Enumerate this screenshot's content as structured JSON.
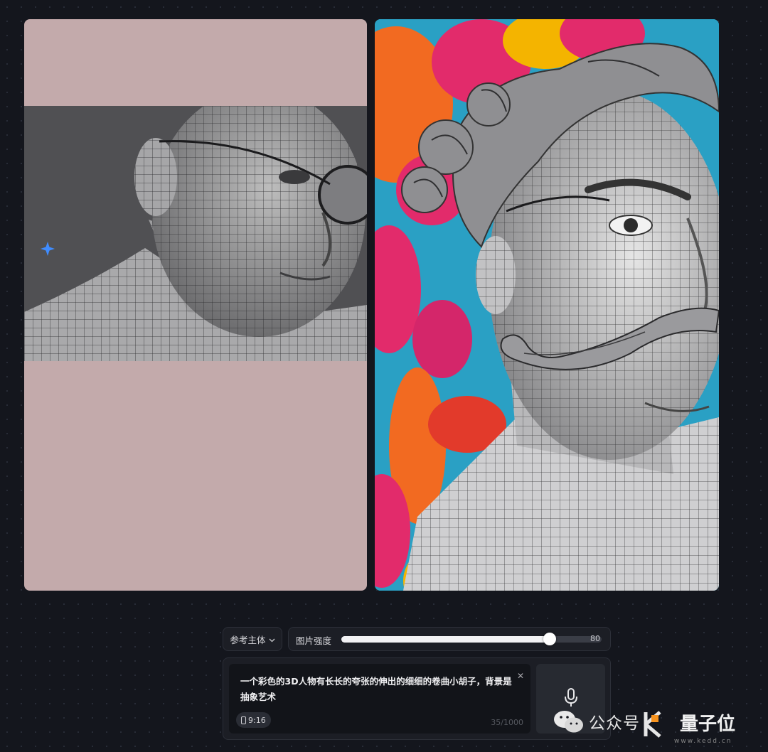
{
  "controls": {
    "subject_label": "参考主体",
    "strength_label": "图片强度",
    "strength_value": "80",
    "strength_fraction": 0.8
  },
  "prompt": {
    "text": "一个彩色的3D人物有长长的夸张的伸出的细细的卷曲小胡子，背景是抽象艺术",
    "ratio": "9:16",
    "char_count": "35/1000"
  },
  "watermark": {
    "text1": "公众号",
    "text2": "量子位",
    "site": "www.kedd.cn"
  },
  "icons": {
    "spark": "sparkle-icon",
    "chevron": "chevron-down-icon",
    "clear": "close-icon",
    "ratio": "phone-icon",
    "mic": "microphone-icon",
    "wechat": "wechat-icon"
  },
  "colors": {
    "page_bg": "#14161d",
    "left_panel_bg": "#c3aaab",
    "accent_blue": "#3f8cff"
  }
}
